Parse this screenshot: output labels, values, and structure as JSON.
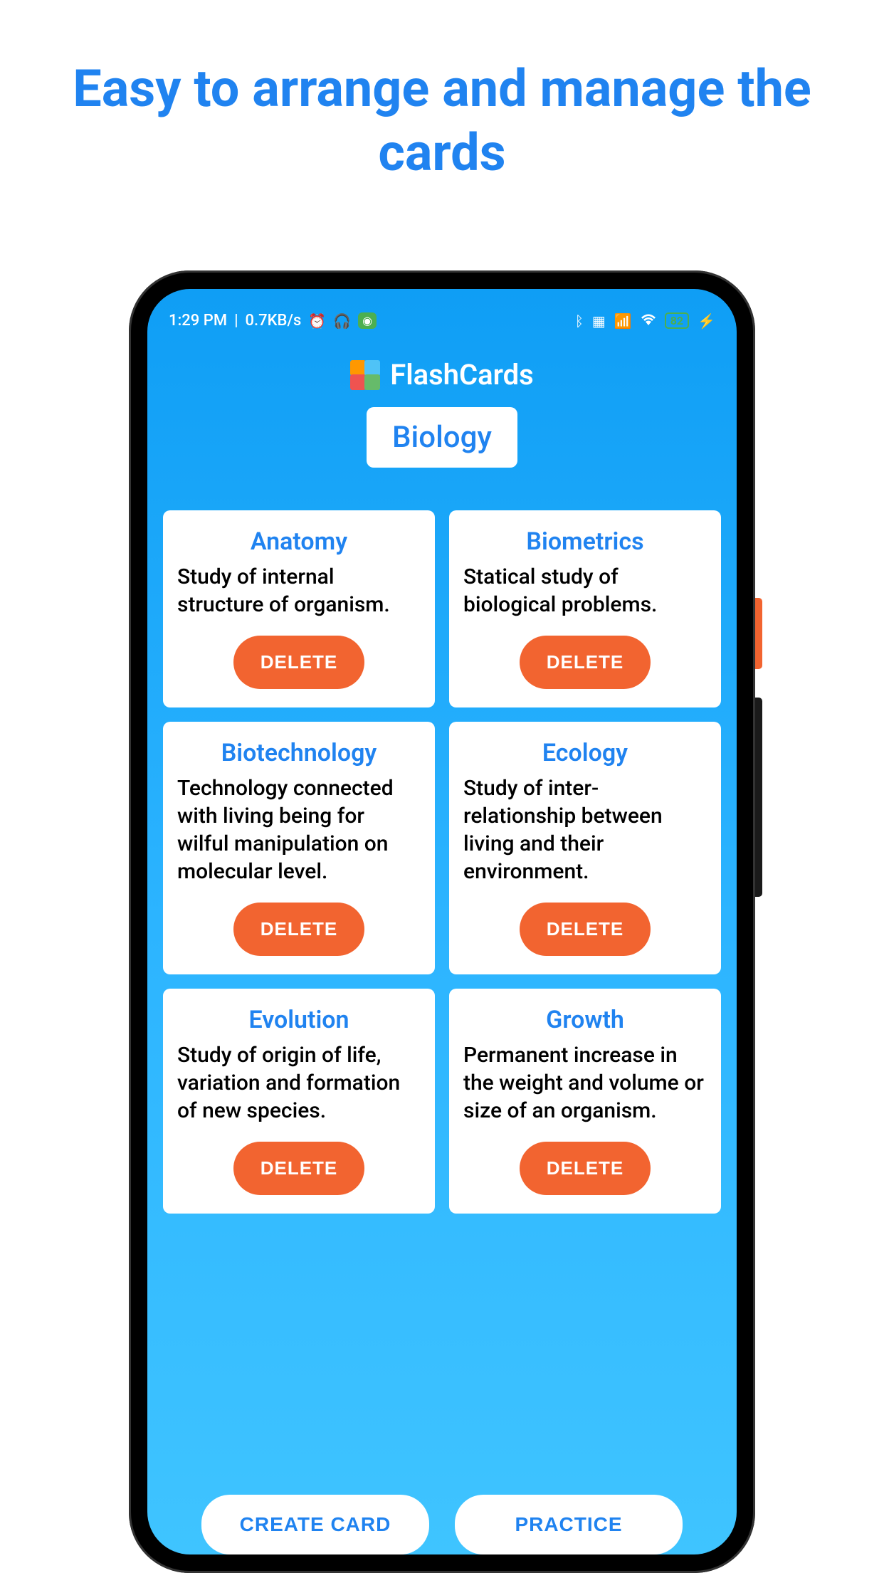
{
  "promo": {
    "title": "Easy to arrange and manage the cards"
  },
  "statusBar": {
    "time": "1:29 PM",
    "dataSpeed": "0.7KB/s",
    "battery": "82"
  },
  "app": {
    "name": "FlashCards",
    "category": "Biology"
  },
  "cards": [
    {
      "title": "Anatomy",
      "desc": "Study of internal structure of organism.",
      "deleteLabel": "DELETE"
    },
    {
      "title": "Biometrics",
      "desc": "Statical study of biological problems.",
      "deleteLabel": "DELETE"
    },
    {
      "title": "Biotechnology",
      "desc": "Technology connected with living being for wilful manipulation on molecular level.",
      "deleteLabel": "DELETE"
    },
    {
      "title": "Ecology",
      "desc": "Study of inter-relationship between living and their environment.",
      "deleteLabel": "DELETE"
    },
    {
      "title": "Evolution",
      "desc": "Study of origin of life, variation and formation of new species.",
      "deleteLabel": "DELETE"
    },
    {
      "title": "Growth",
      "desc": "Permanent increase in the weight and volume or size of an organism.",
      "deleteLabel": "DELETE"
    }
  ],
  "buttons": {
    "createCard": "CREATE CARD",
    "practice": "PRACTICE"
  }
}
